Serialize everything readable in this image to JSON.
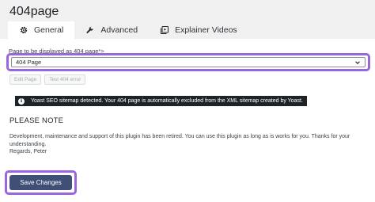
{
  "page": {
    "title": "404page"
  },
  "tabs": [
    {
      "label": "General",
      "icon": "gear-icon",
      "active": true
    },
    {
      "label": "Advanced",
      "icon": "wrench-icon",
      "active": false
    },
    {
      "label": "Explainer Videos",
      "icon": "video-icon",
      "active": false
    }
  ],
  "form": {
    "page_label": "Page to be displayed as 404 page*>",
    "page_select_value": "404 Page",
    "edit_page_label": "Edit Page",
    "test_label": "Test 404 error"
  },
  "notice": {
    "icon": "info-icon",
    "text": "Yoast SEO sitemap detected. Your 404 page is automatically excluded from the XML sitemap created by Yoast."
  },
  "note": {
    "heading": "PLEASE NOTE",
    "body_line1": "Development, maintenance and support of this plugin has been retired. You can use this plugin as long as is works for you. Thanks for your",
    "body_line2": "understanding.",
    "body_line3": "Regards, Peter"
  },
  "actions": {
    "save_label": "Save Changes"
  },
  "colors": {
    "highlight": "#9966dd",
    "save_button": "#3f4f75",
    "header_bg": "#f0f0f1",
    "notice_bg": "#1d2327"
  }
}
